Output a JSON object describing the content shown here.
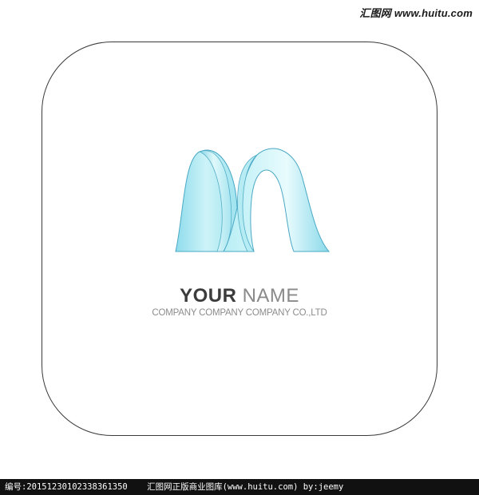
{
  "watermark": {
    "site_text": "汇图网 www.huitu.com"
  },
  "logo": {
    "icon": "ribbon-m-logo",
    "colors": {
      "ribbon_light": "#dff8fb",
      "ribbon_mid": "#9fe3ef",
      "ribbon_dark": "#6fcfe0",
      "outline": "#4aa8c4"
    },
    "name_word_1": "YOUR",
    "name_word_2": "NAME",
    "tagline": "COMPANY COMPANY COMPANY CO.,LTD"
  },
  "footer": {
    "serial": "编号:20151230102338361350",
    "copyright": "汇图网正版商业图库(www.huitu.com) by:jeemy"
  }
}
